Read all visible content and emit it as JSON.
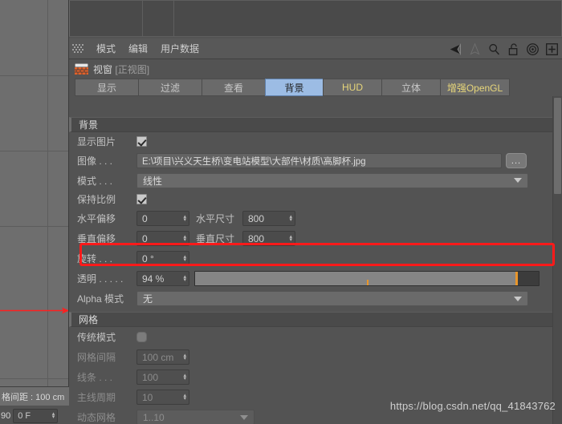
{
  "app": {
    "viewport_status": "格间距 : 100 cm",
    "frame_number": "90",
    "frame_field": "0 F",
    "watermark": "https://blog.csdn.net/qq_41843762"
  },
  "menubar": {
    "grip_icon": "grip-dots-icon",
    "items": [
      {
        "label": "模式"
      },
      {
        "label": "编辑"
      },
      {
        "label": "用户数据"
      }
    ],
    "tools": [
      {
        "name": "cone-left-filled-icon"
      },
      {
        "name": "cone-up-outline-icon"
      },
      {
        "name": "search-icon"
      },
      {
        "name": "lock-open-icon"
      },
      {
        "name": "target-icon"
      },
      {
        "name": "plus-box-icon"
      }
    ]
  },
  "title": {
    "icon": "viewport-brick-icon",
    "name": "视窗",
    "subtitle": "[正视图]"
  },
  "tabs": [
    {
      "label": "显示",
      "selected": false,
      "accent": false
    },
    {
      "label": "过滤",
      "selected": false,
      "accent": false
    },
    {
      "label": "查看",
      "selected": false,
      "accent": false
    },
    {
      "label": "背景",
      "selected": true,
      "accent": false
    },
    {
      "label": "HUD",
      "selected": false,
      "accent": true
    },
    {
      "label": "立体",
      "selected": false,
      "accent": false
    },
    {
      "label": "增强OpenGL",
      "selected": false,
      "accent": true
    }
  ],
  "background": {
    "group_label": "背景",
    "show_image": {
      "label": "显示图片",
      "checked": true
    },
    "image": {
      "label": "图像 . . .",
      "value": "E:\\项目\\兴义天生桥\\变电站模型\\大部件\\材质\\高脚杯.jpg",
      "browse_label": "..."
    },
    "mode": {
      "label": "模式 . . .",
      "value": "线性"
    },
    "keep_ratio": {
      "label": "保持比例",
      "checked": true
    },
    "h_offset": {
      "label": "水平偏移",
      "value": "0"
    },
    "h_size": {
      "label": "水平尺寸",
      "value": "800"
    },
    "v_offset": {
      "label": "垂直偏移",
      "value": "0"
    },
    "v_size": {
      "label": "垂直尺寸",
      "value": "800"
    },
    "rotation": {
      "label": "旋转 . . .",
      "value": "0 °"
    },
    "transparency": {
      "label": "透明 . . . . .",
      "value": "94 %",
      "percent": 94,
      "tick_percent": 50,
      "highlight_color": "#ff1a1a",
      "handle_color": "#e8952a"
    },
    "alpha_mode": {
      "label": "Alpha 模式",
      "value": "无"
    }
  },
  "grid": {
    "group_label": "网格",
    "legacy_mode": {
      "label": "传统模式",
      "checked": false
    },
    "grid_spacing": {
      "label": "网格间隔",
      "value": "100 cm"
    },
    "lines": {
      "label": "线条 . . .",
      "value": "100"
    },
    "major_period": {
      "label": "主线周期",
      "value": "10"
    },
    "dynamic_grid": {
      "label": "动态网格",
      "value": "1..10"
    }
  }
}
